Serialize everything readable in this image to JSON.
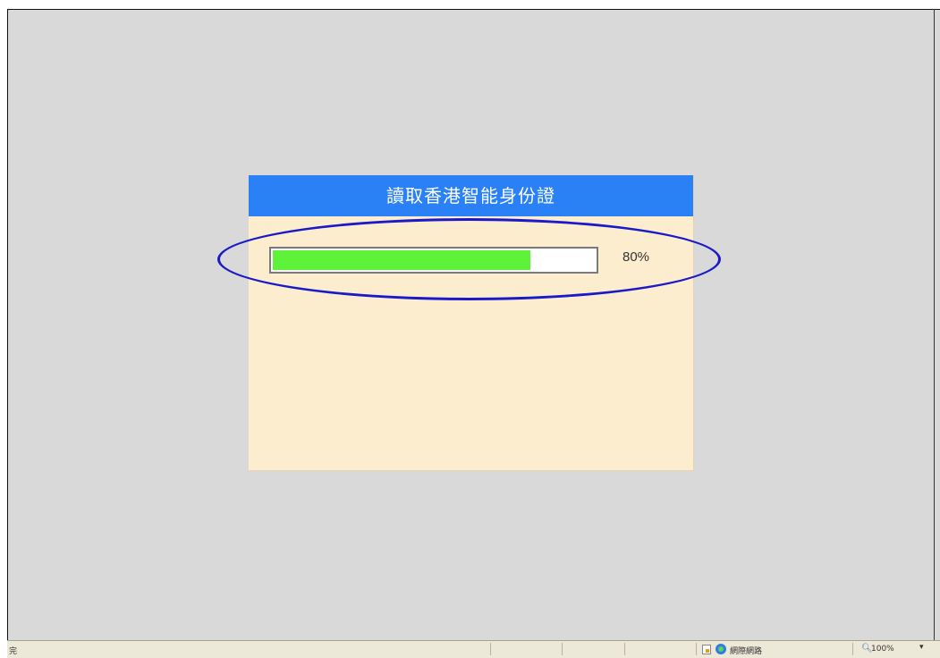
{
  "dialog": {
    "title": "讀取香港智能身份證",
    "progress": {
      "fraction": 0.8,
      "label": "80%"
    }
  },
  "colors": {
    "header_bg": "#2a80f5",
    "dialog_bg": "#fdedcf",
    "progress_fill": "#5ef23a",
    "highlight_ring": "#1a1ac9",
    "page_bg": "#d9d9d9"
  },
  "statusbar": {
    "left_text": "完",
    "zone_text": "網際網路",
    "zoom_text": "100%",
    "icons": [
      "page-icon",
      "globe-icon",
      "zoom-icon"
    ]
  }
}
